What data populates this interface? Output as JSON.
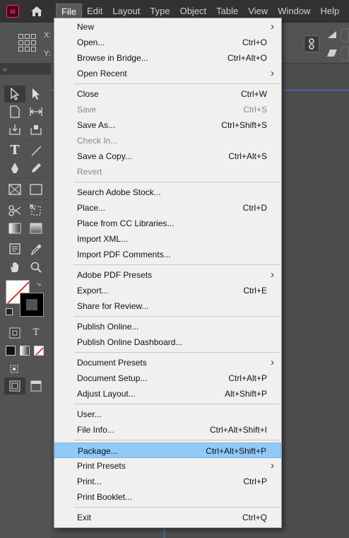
{
  "app": {
    "logo": "Id"
  },
  "menubar": {
    "items": [
      "File",
      "Edit",
      "Layout",
      "Type",
      "Object",
      "Table",
      "View",
      "Window",
      "Help"
    ]
  },
  "controlbar": {
    "x_label": "X:",
    "y_label": "Y:"
  },
  "file_menu": {
    "groups": [
      [
        {
          "label": "New",
          "shortcut": "",
          "submenu": true,
          "disabled": false
        },
        {
          "label": "Open...",
          "shortcut": "Ctrl+O",
          "submenu": false,
          "disabled": false
        },
        {
          "label": "Browse in Bridge...",
          "shortcut": "Ctrl+Alt+O",
          "submenu": false,
          "disabled": false
        },
        {
          "label": "Open Recent",
          "shortcut": "",
          "submenu": true,
          "disabled": false
        }
      ],
      [
        {
          "label": "Close",
          "shortcut": "Ctrl+W",
          "submenu": false,
          "disabled": false
        },
        {
          "label": "Save",
          "shortcut": "Ctrl+S",
          "submenu": false,
          "disabled": true
        },
        {
          "label": "Save As...",
          "shortcut": "Ctrl+Shift+S",
          "submenu": false,
          "disabled": false
        },
        {
          "label": "Check In...",
          "shortcut": "",
          "submenu": false,
          "disabled": true
        },
        {
          "label": "Save a Copy...",
          "shortcut": "Ctrl+Alt+S",
          "submenu": false,
          "disabled": false
        },
        {
          "label": "Revert",
          "shortcut": "",
          "submenu": false,
          "disabled": true
        }
      ],
      [
        {
          "label": "Search Adobe Stock...",
          "shortcut": "",
          "submenu": false,
          "disabled": false
        },
        {
          "label": "Place...",
          "shortcut": "Ctrl+D",
          "submenu": false,
          "disabled": false
        },
        {
          "label": "Place from CC Libraries...",
          "shortcut": "",
          "submenu": false,
          "disabled": false
        },
        {
          "label": "Import XML...",
          "shortcut": "",
          "submenu": false,
          "disabled": false
        },
        {
          "label": "Import PDF Comments...",
          "shortcut": "",
          "submenu": false,
          "disabled": false
        }
      ],
      [
        {
          "label": "Adobe PDF Presets",
          "shortcut": "",
          "submenu": true,
          "disabled": false
        },
        {
          "label": "Export...",
          "shortcut": "Ctrl+E",
          "submenu": false,
          "disabled": false
        },
        {
          "label": "Share for Review...",
          "shortcut": "",
          "submenu": false,
          "disabled": false
        }
      ],
      [
        {
          "label": "Publish Online...",
          "shortcut": "",
          "submenu": false,
          "disabled": false
        },
        {
          "label": "Publish Online Dashboard...",
          "shortcut": "",
          "submenu": false,
          "disabled": false
        }
      ],
      [
        {
          "label": "Document Presets",
          "shortcut": "",
          "submenu": true,
          "disabled": false
        },
        {
          "label": "Document Setup...",
          "shortcut": "Ctrl+Alt+P",
          "submenu": false,
          "disabled": false
        },
        {
          "label": "Adjust Layout...",
          "shortcut": "Alt+Shift+P",
          "submenu": false,
          "disabled": false
        }
      ],
      [
        {
          "label": "User...",
          "shortcut": "",
          "submenu": false,
          "disabled": false
        },
        {
          "label": "File Info...",
          "shortcut": "Ctrl+Alt+Shift+I",
          "submenu": false,
          "disabled": false
        }
      ],
      [
        {
          "label": "Package...",
          "shortcut": "Ctrl+Alt+Shift+P",
          "submenu": false,
          "disabled": false,
          "highlighted": true
        },
        {
          "label": "Print Presets",
          "shortcut": "",
          "submenu": true,
          "disabled": false
        },
        {
          "label": "Print...",
          "shortcut": "Ctrl+P",
          "submenu": false,
          "disabled": false
        },
        {
          "label": "Print Booklet...",
          "shortcut": "",
          "submenu": false,
          "disabled": false
        }
      ],
      [
        {
          "label": "Exit",
          "shortcut": "Ctrl+Q",
          "submenu": false,
          "disabled": false
        }
      ]
    ]
  },
  "toolbar": {
    "collapse_glyph": "‹‹",
    "type_label": "T"
  },
  "colors": {
    "accent": "#91c9f7",
    "app_logo": "#ff3366",
    "guide": "#3d7dff"
  }
}
